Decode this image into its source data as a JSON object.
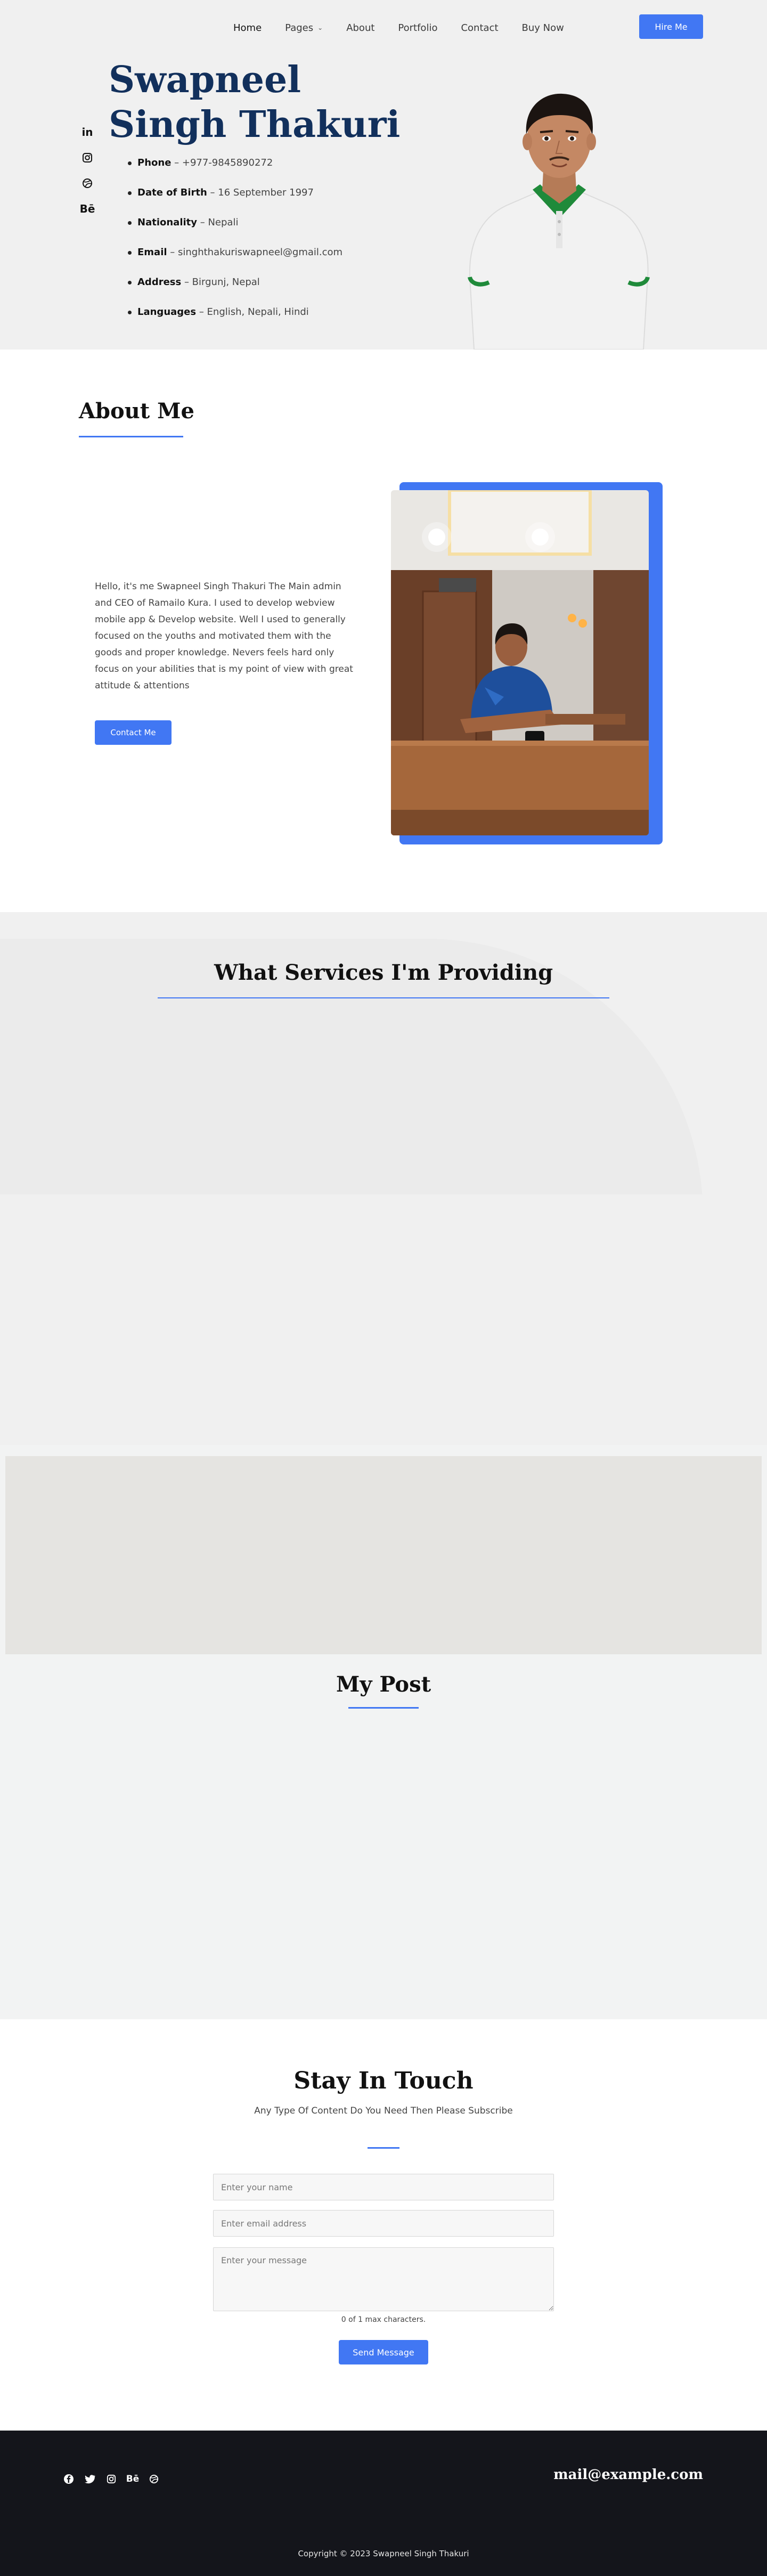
{
  "nav": {
    "items": [
      {
        "label": "Home"
      },
      {
        "label": "Pages"
      },
      {
        "label": "About"
      },
      {
        "label": "Portfolio"
      },
      {
        "label": "Contact"
      },
      {
        "label": "Buy Now"
      }
    ],
    "hire_label": "Hire Me"
  },
  "hero": {
    "name": "Swapneel Singh Thakuri",
    "social_icons": [
      "linkedin-icon",
      "instagram-icon",
      "dribbble-icon",
      "behance-icon"
    ],
    "details": [
      {
        "key": "Phone",
        "value": "+977-9845890272"
      },
      {
        "key": "Date of Birth",
        "value": "16 September 1997"
      },
      {
        "key": "Nationality",
        "value": "Nepali"
      },
      {
        "key": "Email",
        "value": "singhthakuriswapneel@gmail.com"
      },
      {
        "key": "Address",
        "value": "Birgunj, Nepal"
      },
      {
        "key": "Languages",
        "value": "English, Nepali, Hindi"
      }
    ]
  },
  "about": {
    "title": "About Me",
    "text": "Hello, it's me Swapneel Singh Thakuri The Main admin and CEO of Ramailo Kura. I used to develop webview mobile app & Develop website. Well I used to generally focused on the youths and motivated them with the goods and proper knowledge. Nevers feels hard only focus on your abilities that is my point of view with great attitude & attentions",
    "button_label": "Contact Me"
  },
  "services": {
    "title": "What Services I'm Providing"
  },
  "posts": {
    "title": "My Post"
  },
  "contact": {
    "title": "Stay In Touch",
    "subtitle": "Any Type Of Content Do You Need Then Please Subscribe",
    "name_placeholder": "Enter your name",
    "email_placeholder": "Enter email address",
    "message_placeholder": "Enter your message",
    "counter": "0 of 1 max characters.",
    "button_label": "Send Message"
  },
  "footer": {
    "social_icons": [
      "facebook-icon",
      "twitter-icon",
      "instagram-icon",
      "behance-icon",
      "dribbble-icon"
    ],
    "email": "mail@example.com",
    "copyright": "Copyright © 2023 Swapneel Singh Thakuri"
  },
  "colors": {
    "accent": "#4177f3",
    "title_navy": "#12305c",
    "footer_bg": "#14151b",
    "hero_bg": "#f0f0f0"
  }
}
